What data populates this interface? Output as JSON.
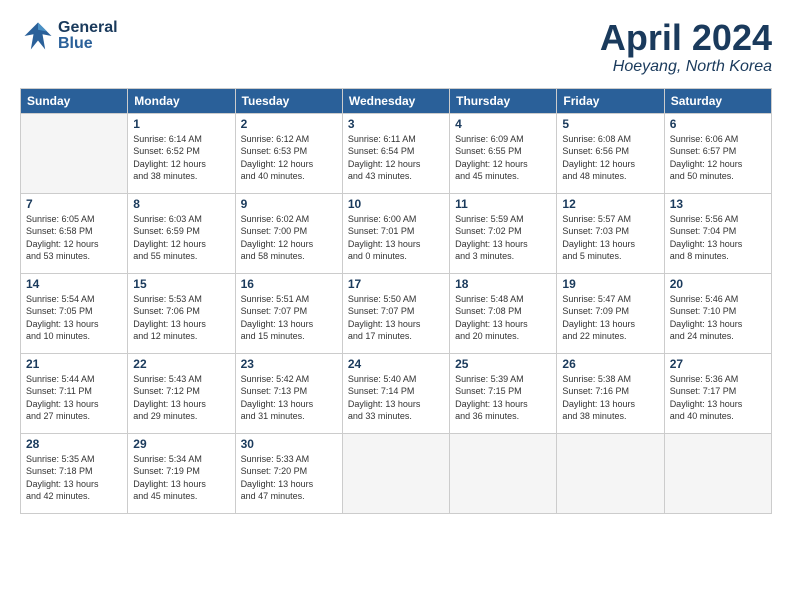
{
  "header": {
    "logo_general": "General",
    "logo_blue": "Blue",
    "month_title": "April 2024",
    "location": "Hoeyang, North Korea"
  },
  "weekdays": [
    "Sunday",
    "Monday",
    "Tuesday",
    "Wednesday",
    "Thursday",
    "Friday",
    "Saturday"
  ],
  "weeks": [
    [
      {
        "day": "",
        "info": ""
      },
      {
        "day": "1",
        "info": "Sunrise: 6:14 AM\nSunset: 6:52 PM\nDaylight: 12 hours\nand 38 minutes."
      },
      {
        "day": "2",
        "info": "Sunrise: 6:12 AM\nSunset: 6:53 PM\nDaylight: 12 hours\nand 40 minutes."
      },
      {
        "day": "3",
        "info": "Sunrise: 6:11 AM\nSunset: 6:54 PM\nDaylight: 12 hours\nand 43 minutes."
      },
      {
        "day": "4",
        "info": "Sunrise: 6:09 AM\nSunset: 6:55 PM\nDaylight: 12 hours\nand 45 minutes."
      },
      {
        "day": "5",
        "info": "Sunrise: 6:08 AM\nSunset: 6:56 PM\nDaylight: 12 hours\nand 48 minutes."
      },
      {
        "day": "6",
        "info": "Sunrise: 6:06 AM\nSunset: 6:57 PM\nDaylight: 12 hours\nand 50 minutes."
      }
    ],
    [
      {
        "day": "7",
        "info": "Sunrise: 6:05 AM\nSunset: 6:58 PM\nDaylight: 12 hours\nand 53 minutes."
      },
      {
        "day": "8",
        "info": "Sunrise: 6:03 AM\nSunset: 6:59 PM\nDaylight: 12 hours\nand 55 minutes."
      },
      {
        "day": "9",
        "info": "Sunrise: 6:02 AM\nSunset: 7:00 PM\nDaylight: 12 hours\nand 58 minutes."
      },
      {
        "day": "10",
        "info": "Sunrise: 6:00 AM\nSunset: 7:01 PM\nDaylight: 13 hours\nand 0 minutes."
      },
      {
        "day": "11",
        "info": "Sunrise: 5:59 AM\nSunset: 7:02 PM\nDaylight: 13 hours\nand 3 minutes."
      },
      {
        "day": "12",
        "info": "Sunrise: 5:57 AM\nSunset: 7:03 PM\nDaylight: 13 hours\nand 5 minutes."
      },
      {
        "day": "13",
        "info": "Sunrise: 5:56 AM\nSunset: 7:04 PM\nDaylight: 13 hours\nand 8 minutes."
      }
    ],
    [
      {
        "day": "14",
        "info": "Sunrise: 5:54 AM\nSunset: 7:05 PM\nDaylight: 13 hours\nand 10 minutes."
      },
      {
        "day": "15",
        "info": "Sunrise: 5:53 AM\nSunset: 7:06 PM\nDaylight: 13 hours\nand 12 minutes."
      },
      {
        "day": "16",
        "info": "Sunrise: 5:51 AM\nSunset: 7:07 PM\nDaylight: 13 hours\nand 15 minutes."
      },
      {
        "day": "17",
        "info": "Sunrise: 5:50 AM\nSunset: 7:07 PM\nDaylight: 13 hours\nand 17 minutes."
      },
      {
        "day": "18",
        "info": "Sunrise: 5:48 AM\nSunset: 7:08 PM\nDaylight: 13 hours\nand 20 minutes."
      },
      {
        "day": "19",
        "info": "Sunrise: 5:47 AM\nSunset: 7:09 PM\nDaylight: 13 hours\nand 22 minutes."
      },
      {
        "day": "20",
        "info": "Sunrise: 5:46 AM\nSunset: 7:10 PM\nDaylight: 13 hours\nand 24 minutes."
      }
    ],
    [
      {
        "day": "21",
        "info": "Sunrise: 5:44 AM\nSunset: 7:11 PM\nDaylight: 13 hours\nand 27 minutes."
      },
      {
        "day": "22",
        "info": "Sunrise: 5:43 AM\nSunset: 7:12 PM\nDaylight: 13 hours\nand 29 minutes."
      },
      {
        "day": "23",
        "info": "Sunrise: 5:42 AM\nSunset: 7:13 PM\nDaylight: 13 hours\nand 31 minutes."
      },
      {
        "day": "24",
        "info": "Sunrise: 5:40 AM\nSunset: 7:14 PM\nDaylight: 13 hours\nand 33 minutes."
      },
      {
        "day": "25",
        "info": "Sunrise: 5:39 AM\nSunset: 7:15 PM\nDaylight: 13 hours\nand 36 minutes."
      },
      {
        "day": "26",
        "info": "Sunrise: 5:38 AM\nSunset: 7:16 PM\nDaylight: 13 hours\nand 38 minutes."
      },
      {
        "day": "27",
        "info": "Sunrise: 5:36 AM\nSunset: 7:17 PM\nDaylight: 13 hours\nand 40 minutes."
      }
    ],
    [
      {
        "day": "28",
        "info": "Sunrise: 5:35 AM\nSunset: 7:18 PM\nDaylight: 13 hours\nand 42 minutes."
      },
      {
        "day": "29",
        "info": "Sunrise: 5:34 AM\nSunset: 7:19 PM\nDaylight: 13 hours\nand 45 minutes."
      },
      {
        "day": "30",
        "info": "Sunrise: 5:33 AM\nSunset: 7:20 PM\nDaylight: 13 hours\nand 47 minutes."
      },
      {
        "day": "",
        "info": ""
      },
      {
        "day": "",
        "info": ""
      },
      {
        "day": "",
        "info": ""
      },
      {
        "day": "",
        "info": ""
      }
    ]
  ]
}
